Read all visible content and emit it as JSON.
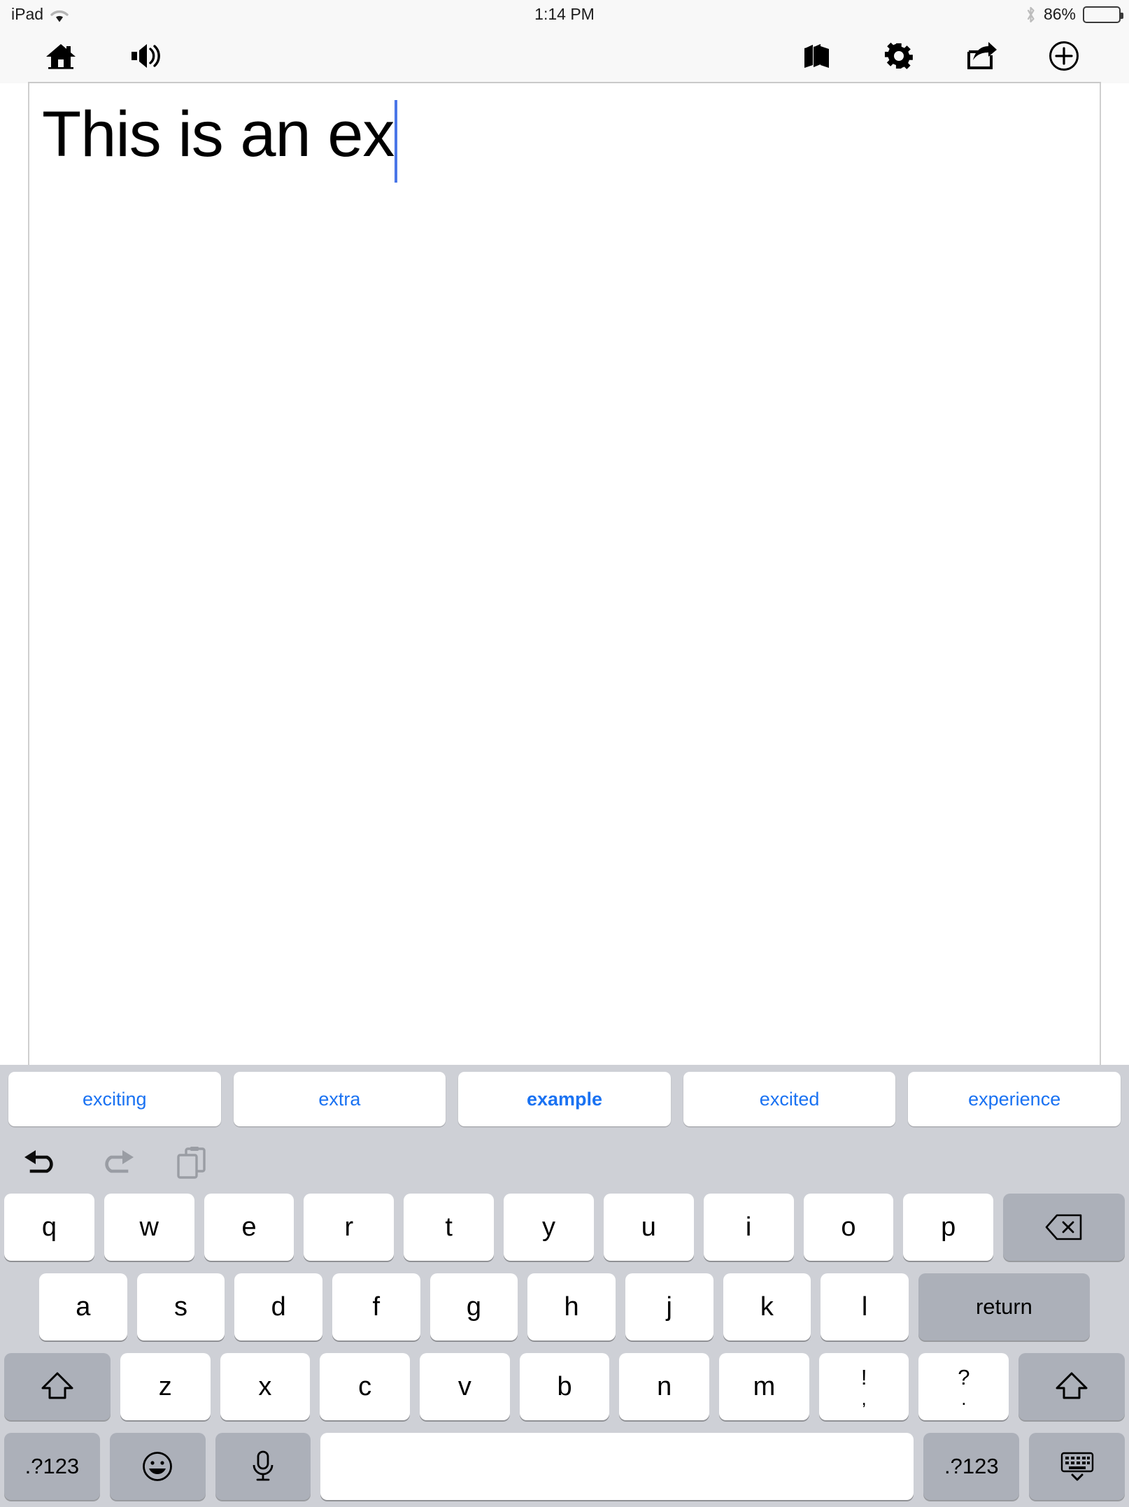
{
  "statusbar": {
    "device": "iPad",
    "wifi_icon": "wifi-icon",
    "time": "1:14 PM",
    "bluetooth_icon": "bluetooth-icon",
    "battery_percent": "86%",
    "battery_level": 86
  },
  "toolbar": {
    "left_items": [
      {
        "name": "home-icon",
        "label": "Home"
      },
      {
        "name": "speaker-icon",
        "label": "Speak"
      }
    ],
    "right_items": [
      {
        "name": "books-icon",
        "label": "Library"
      },
      {
        "name": "gear-icon",
        "label": "Settings"
      },
      {
        "name": "share-icon",
        "label": "Share"
      },
      {
        "name": "plus-circle-icon",
        "label": "Add"
      }
    ]
  },
  "document": {
    "text": "This is an ex",
    "caret_color": "#4a76e8"
  },
  "suggestions": {
    "items": [
      {
        "label": "exciting",
        "highlighted": false
      },
      {
        "label": "extra",
        "highlighted": false
      },
      {
        "label": "example",
        "highlighted": true
      },
      {
        "label": "excited",
        "highlighted": false
      },
      {
        "label": "experience",
        "highlighted": false
      }
    ],
    "text_color": "#1a72f2"
  },
  "edit_row": {
    "items": [
      {
        "name": "undo-icon",
        "label": "Undo",
        "enabled": true
      },
      {
        "name": "redo-icon",
        "label": "Redo",
        "enabled": false
      },
      {
        "name": "paste-icon",
        "label": "Paste",
        "enabled": false
      }
    ]
  },
  "keyboard": {
    "row1": [
      "q",
      "w",
      "e",
      "r",
      "t",
      "y",
      "u",
      "i",
      "o",
      "p"
    ],
    "row1_action": {
      "label": "",
      "name": "backspace-key"
    },
    "row2": [
      "a",
      "s",
      "d",
      "f",
      "g",
      "h",
      "j",
      "k",
      "l"
    ],
    "row2_action": {
      "label": "return",
      "name": "return-key"
    },
    "row3_shift_left": {
      "label": "",
      "name": "shift-left-key"
    },
    "row3": [
      "z",
      "x",
      "c",
      "v",
      "b",
      "n",
      "m"
    ],
    "row3_punct": [
      {
        "top": "!",
        "bot": ","
      },
      {
        "top": "?",
        "bot": "."
      }
    ],
    "row3_shift_right": {
      "label": "",
      "name": "shift-right-key"
    },
    "row4": {
      "numbers_left": ".?123",
      "emoji": "emoji-icon",
      "mic": "microphone-icon",
      "space": "",
      "numbers_right": ".?123",
      "dismiss": "keyboard-dismiss-icon"
    }
  }
}
